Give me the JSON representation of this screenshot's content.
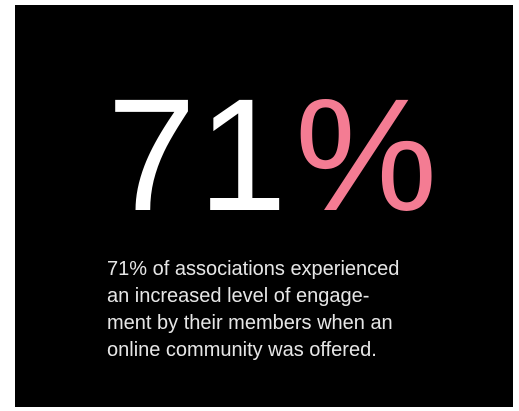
{
  "stat": {
    "number": "71",
    "percent_sign": "%"
  },
  "caption": {
    "lines": [
      "71% of associations experienced",
      "an increased level of engage-",
      "ment by their members when an",
      "online community was offered."
    ]
  },
  "colors": {
    "background": "#000000",
    "number": "#ffffff",
    "accent": "#f47c93",
    "caption": "#e6e6e6"
  }
}
